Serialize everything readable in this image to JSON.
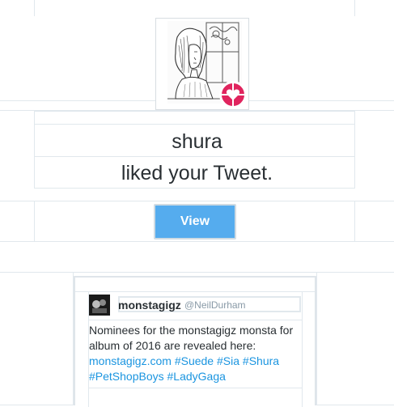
{
  "notification": {
    "user_name": "shura",
    "action_text": "liked your Tweet.",
    "icon": "heart-icon",
    "accent_color": "#e0245e"
  },
  "view_button": {
    "label": "View",
    "color": "#55acee"
  },
  "tweet": {
    "author_name": "monstagigz",
    "author_handle": "@NeilDurham",
    "text_line1": "Nominees for the monstagigz monsta for",
    "text_line2": "album of 2016 are revealed here:",
    "link_url": "monstagigz.com",
    "hashtag1": "#Suede",
    "hashtag2": "#Sia",
    "hashtag3": "#Shura",
    "hashtag4": "#PetShopBoys",
    "hashtag5": "#LadyGaga",
    "link_color": "#1b95e0"
  }
}
